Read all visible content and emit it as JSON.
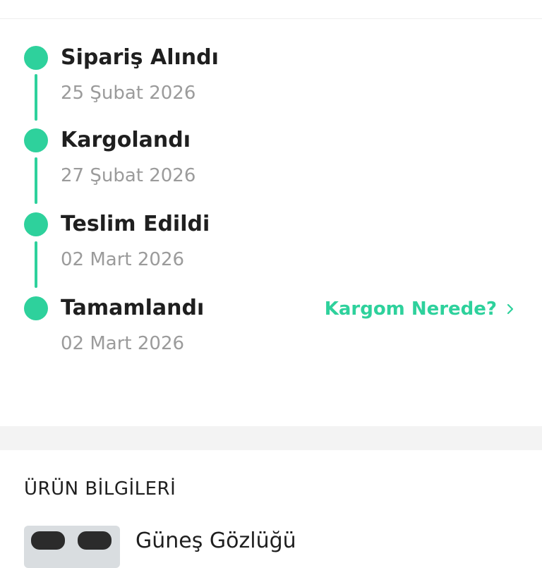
{
  "timeline": {
    "steps": [
      {
        "title": "Sipariş Alındı",
        "date": "25 Şubat 2026"
      },
      {
        "title": "Kargolandı",
        "date": "27 Şubat 2026"
      },
      {
        "title": "Teslim Edildi",
        "date": "02 Mart 2026"
      },
      {
        "title": "Tamamlandı",
        "date": "02 Mart 2026"
      }
    ],
    "track_link": "Kargom Nerede?",
    "accent_color": "#2ed19c"
  },
  "products": {
    "heading": "ÜRÜN BİLGİLERİ",
    "items": [
      {
        "name": "Güneş Gözlüğü"
      }
    ]
  }
}
